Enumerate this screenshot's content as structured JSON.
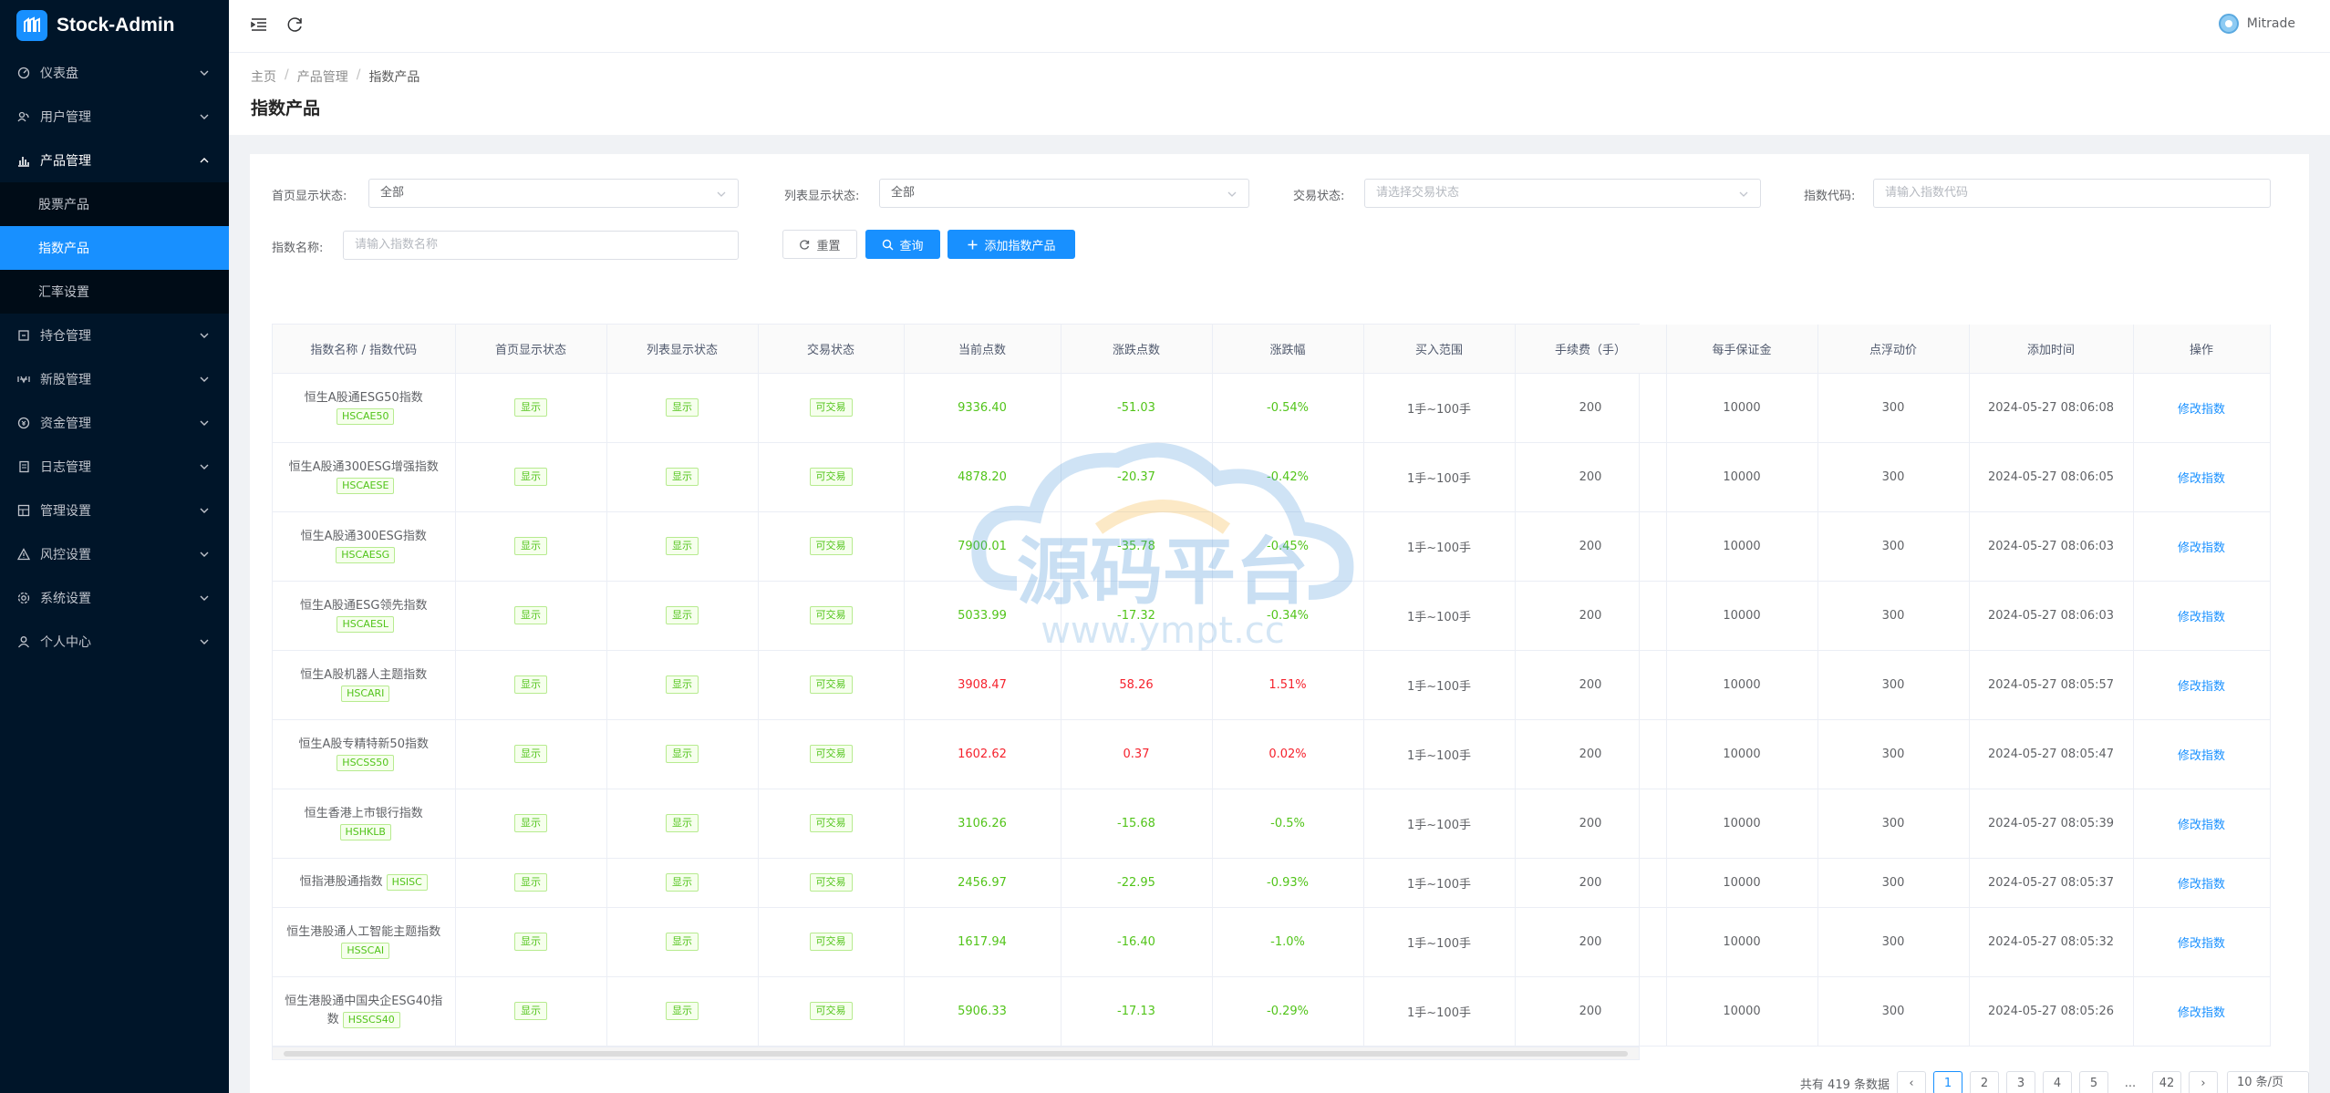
{
  "app": {
    "title": "Stock-Admin"
  },
  "user": {
    "name": "Mitrade"
  },
  "sidebar": {
    "items": [
      {
        "label": "仪表盘"
      },
      {
        "label": "用户管理"
      },
      {
        "label": "产品管理"
      },
      {
        "label": "持仓管理"
      },
      {
        "label": "新股管理"
      },
      {
        "label": "资金管理"
      },
      {
        "label": "日志管理"
      },
      {
        "label": "管理设置"
      },
      {
        "label": "风控设置"
      },
      {
        "label": "系统设置"
      },
      {
        "label": "个人中心"
      }
    ],
    "sub": [
      {
        "label": "股票产品"
      },
      {
        "label": "指数产品"
      },
      {
        "label": "汇率设置"
      }
    ]
  },
  "breadcrumb": {
    "home": "主页",
    "section": "产品管理",
    "current": "指数产品"
  },
  "page": {
    "title": "指数产品"
  },
  "filters": {
    "home_status_label": "首页显示状态:",
    "home_status_value": "全部",
    "list_status_label": "列表显示状态:",
    "list_status_value": "全部",
    "trade_status_label": "交易状态:",
    "trade_status_placeholder": "请选择交易状态",
    "code_label": "指数代码:",
    "code_placeholder": "请输入指数代码",
    "name_label": "指数名称:",
    "name_placeholder": "请输入指数名称",
    "reset_label": "重置",
    "search_label": "查询",
    "add_label": "添加指数产品"
  },
  "table": {
    "headers": [
      "指数名称 / 指数代码",
      "首页显示状态",
      "列表显示状态",
      "交易状态",
      "当前点数",
      "涨跌点数",
      "涨跌幅",
      "买入范围",
      "手续费（手）",
      "每手保证金",
      "点浮动价",
      "添加时间",
      "操作"
    ],
    "show_label": "显示",
    "tradable_label": "可交易",
    "range_label": "1手~100手",
    "edit_label": "修改指数",
    "rows": [
      {
        "name": "恒生A股通ESG50指数",
        "code": "HSCAE50",
        "price": "9336.40",
        "change": "-51.03",
        "pct": "-0.54%",
        "fee": "200",
        "margin": "10000",
        "float": "300",
        "time": "2024-05-27 08:06:08"
      },
      {
        "name": "恒生A股通300ESG增强指数",
        "code": "HSCAESE",
        "price": "4878.20",
        "change": "-20.37",
        "pct": "-0.42%",
        "fee": "200",
        "margin": "10000",
        "float": "300",
        "time": "2024-05-27 08:06:05"
      },
      {
        "name": "恒生A股通300ESG指数",
        "code": "HSCAESG",
        "price": "7900.01",
        "change": "-35.78",
        "pct": "-0.45%",
        "fee": "200",
        "margin": "10000",
        "float": "300",
        "time": "2024-05-27 08:06:03"
      },
      {
        "name": "恒生A股通ESG领先指数",
        "code": "HSCAESL",
        "price": "5033.99",
        "change": "-17.32",
        "pct": "-0.34%",
        "fee": "200",
        "margin": "10000",
        "float": "300",
        "time": "2024-05-27 08:06:03"
      },
      {
        "name": "恒生A股机器人主题指数",
        "code": "HSCARI",
        "price": "3908.47",
        "change": "58.26",
        "pct": "1.51%",
        "fee": "200",
        "margin": "10000",
        "float": "300",
        "time": "2024-05-27 08:05:57"
      },
      {
        "name": "恒生A股专精特新50指数",
        "code": "HSCSS50",
        "price": "1602.62",
        "change": "0.37",
        "pct": "0.02%",
        "fee": "200",
        "margin": "10000",
        "float": "300",
        "time": "2024-05-27 08:05:47"
      },
      {
        "name": "恒生香港上市银行指数",
        "code": "HSHKLB",
        "price": "3106.26",
        "change": "-15.68",
        "pct": "-0.5%",
        "fee": "200",
        "margin": "10000",
        "float": "300",
        "time": "2024-05-27 08:05:39"
      },
      {
        "name": "恒指港股通指数",
        "code": "HSISC",
        "price": "2456.97",
        "change": "-22.95",
        "pct": "-0.93%",
        "fee": "200",
        "margin": "10000",
        "float": "300",
        "time": "2024-05-27 08:05:37"
      },
      {
        "name": "恒生港股通人工智能主题指数",
        "code": "HSSCAI",
        "price": "1617.94",
        "change": "-16.40",
        "pct": "-1.0%",
        "fee": "200",
        "margin": "10000",
        "float": "300",
        "time": "2024-05-27 08:05:32"
      },
      {
        "name": "恒生港股通中国央企ESG40指数",
        "code": "HSSCS40",
        "price": "5906.33",
        "change": "-17.13",
        "pct": "-0.29%",
        "fee": "200",
        "margin": "10000",
        "float": "300",
        "time": "2024-05-27 08:05:26"
      }
    ]
  },
  "watermark": {
    "text_cn": "源码平台",
    "text_url": "www.ympt.cc"
  },
  "pagination": {
    "total": "共有 419 条数据",
    "pages": [
      "1",
      "2",
      "3",
      "4",
      "5",
      "...",
      "42"
    ],
    "size": "10 条/页"
  },
  "colors": {
    "accent": "#1890ff",
    "up": "#f5222d",
    "down": "#52c41a",
    "sidebar": "#001529"
  }
}
